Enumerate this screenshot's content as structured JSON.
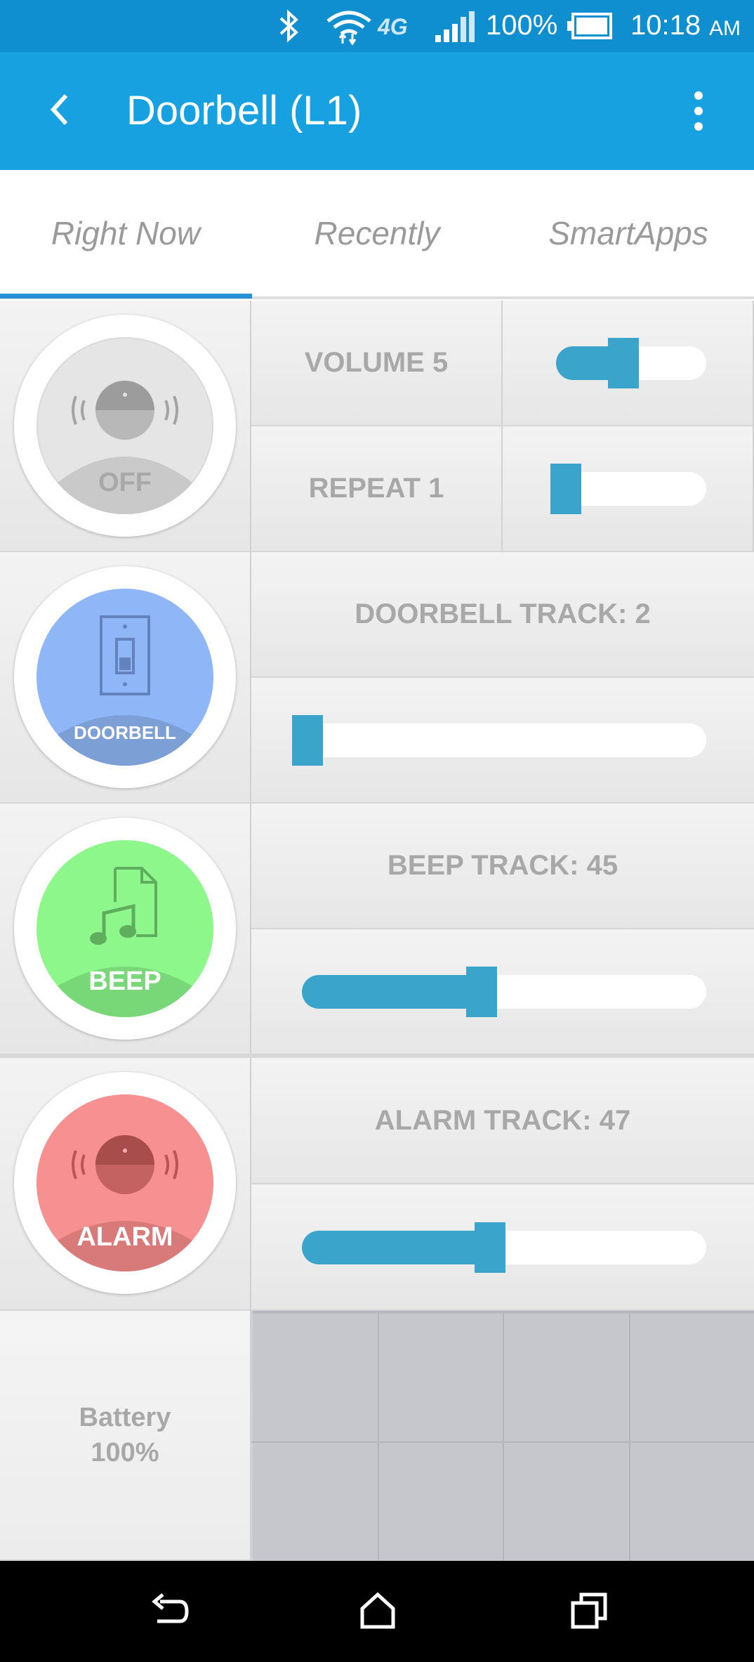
{
  "status_bar": {
    "network_type": "4G",
    "battery_percent": "100%",
    "time": "10:18",
    "ampm": "AM",
    "icons": [
      "bluetooth-icon",
      "wifi-icon",
      "signal-icon",
      "battery-icon"
    ]
  },
  "app_bar": {
    "title": "Doorbell (L1)",
    "back_icon": "chevron-left-icon",
    "menu_icon": "more-vert-icon"
  },
  "tabs": [
    {
      "label": "Right Now",
      "active": true
    },
    {
      "label": "Recently",
      "active": false
    },
    {
      "label": "SmartApps",
      "active": false
    }
  ],
  "device_tiles": {
    "off": {
      "label": "OFF",
      "color": "#e5e5e5",
      "icon": "ringing-head-icon"
    },
    "doorbell": {
      "label": "DOORBELL",
      "color": "#8fb6f7",
      "icon": "door-switch-icon"
    },
    "beep": {
      "label": "BEEP",
      "color": "#8ef78c",
      "icon": "music-file-icon"
    },
    "alarm": {
      "label": "ALARM",
      "color": "#f79191",
      "icon": "ringing-head-icon"
    }
  },
  "controls": {
    "volume": {
      "label": "VOLUME 5",
      "value": 0.55
    },
    "repeat": {
      "label": "REPEAT 1",
      "value": 0.0
    },
    "doorbell_track": {
      "label": "DOORBELL TRACK: 2",
      "value": 0.0
    },
    "beep_track": {
      "label": "BEEP TRACK: 45",
      "value": 0.45
    },
    "alarm_track": {
      "label": "ALARM TRACK: 47",
      "value": 0.47
    }
  },
  "battery": {
    "label": "Battery",
    "value": "100%"
  },
  "nav_bar": {
    "icons": [
      "back-icon",
      "home-icon",
      "recents-icon"
    ]
  },
  "accent_color": "#3aa4cb"
}
